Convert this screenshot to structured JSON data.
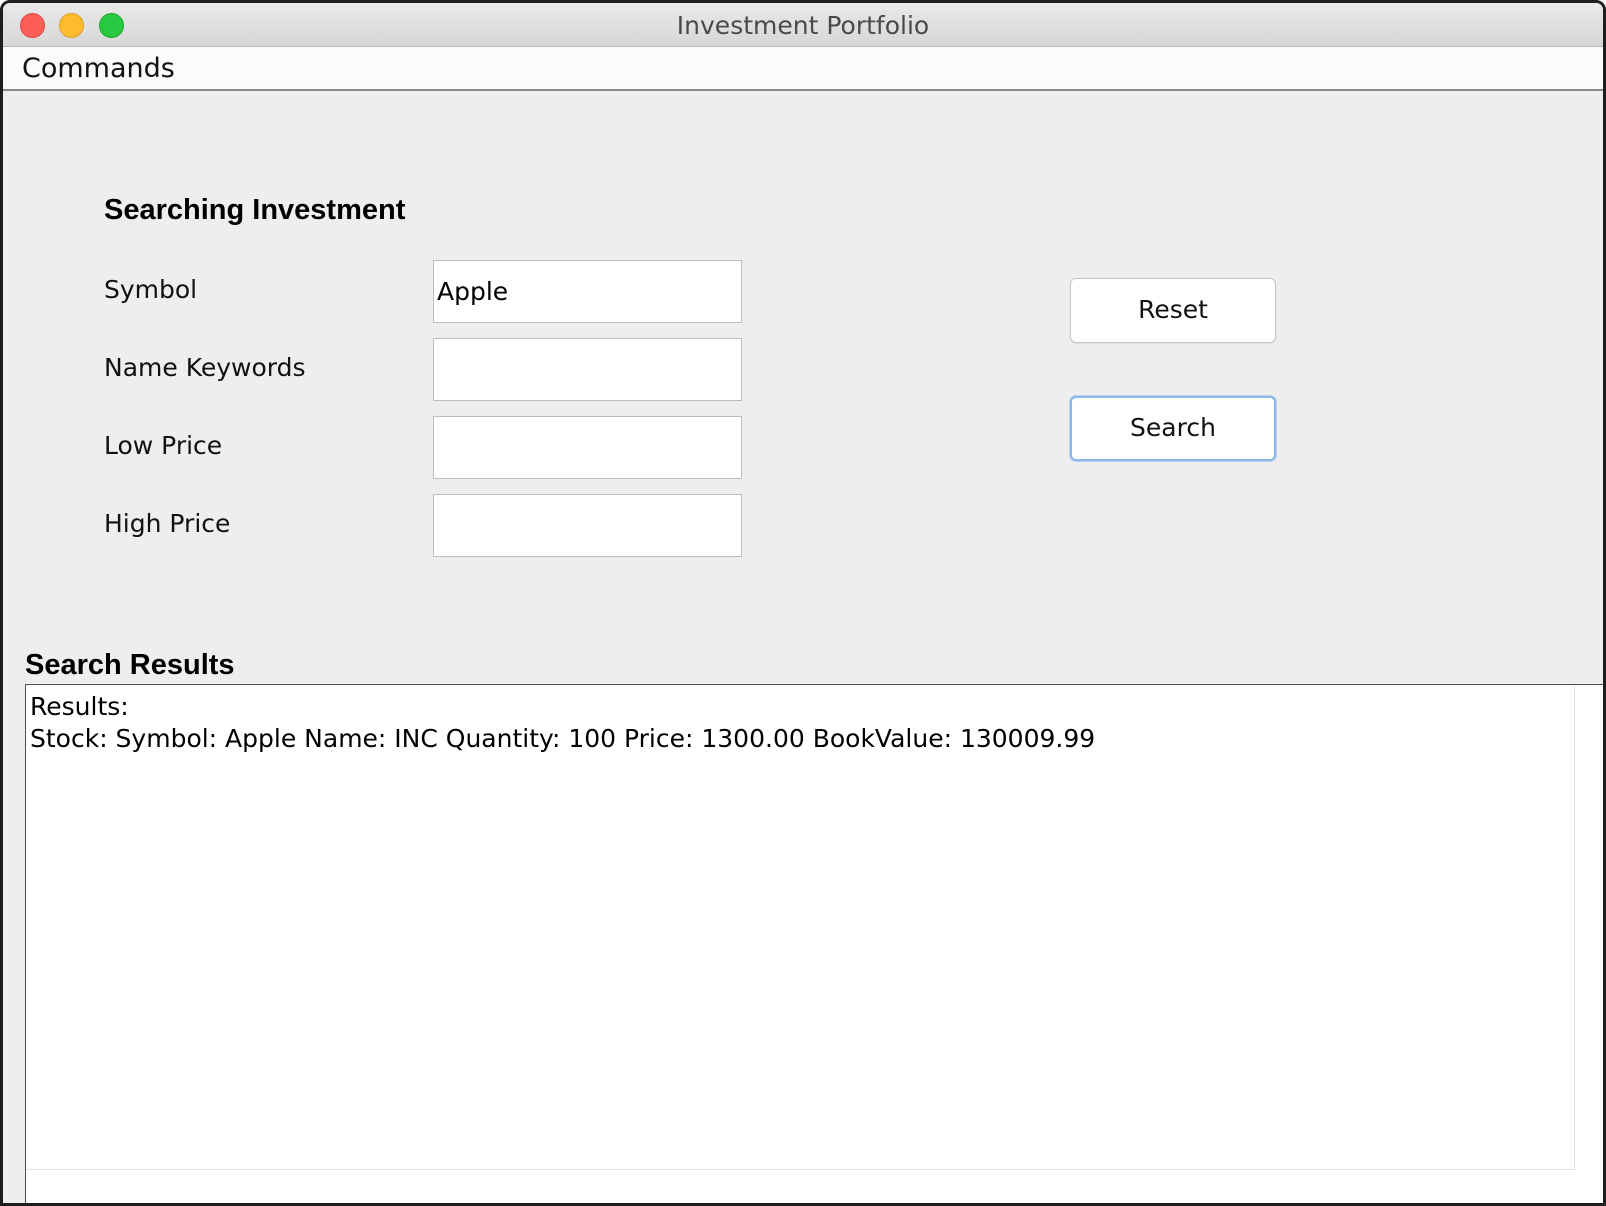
{
  "window": {
    "title": "Investment Portfolio"
  },
  "menubar": {
    "items": [
      {
        "label": "Commands"
      }
    ]
  },
  "form": {
    "title": "Searching Investment",
    "fields": [
      {
        "label": "Symbol",
        "value": "Apple"
      },
      {
        "label": "Name Keywords",
        "value": ""
      },
      {
        "label": "Low Price",
        "value": ""
      },
      {
        "label": "High Price",
        "value": ""
      }
    ],
    "buttons": {
      "reset_label": "Reset",
      "search_label": "Search"
    }
  },
  "results": {
    "title": "Search Results",
    "lines": [
      "Results:",
      "Stock: Symbol: Apple Name: INC Quantity: 100 Price: 1300.00 BookValue: 130009.99"
    ]
  },
  "colors": {
    "close": "#fc5f57",
    "minimize": "#fdbc2e",
    "maximize": "#28c840",
    "focus_ring": "#8db6ec"
  }
}
